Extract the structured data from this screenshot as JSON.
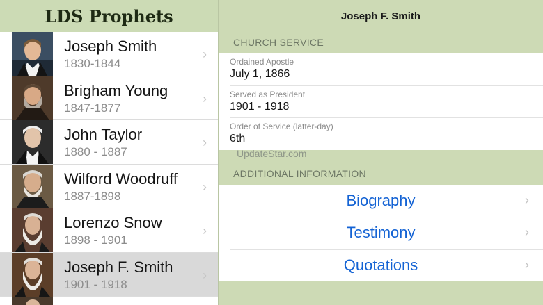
{
  "app": {
    "title": "LDS Prophets"
  },
  "prophets": [
    {
      "name": "Joseph Smith",
      "years": "1830-1844"
    },
    {
      "name": "Brigham Young",
      "years": "1847-1877"
    },
    {
      "name": "John Taylor",
      "years": "1880 - 1887"
    },
    {
      "name": "Wilford Woodruff",
      "years": "1887-1898"
    },
    {
      "name": "Lorenzo Snow",
      "years": "1898 - 1901"
    },
    {
      "name": "Joseph F. Smith",
      "years": "1901 - 1918"
    }
  ],
  "detail": {
    "title": "Joseph F. Smith",
    "church_service_label": "CHURCH SERVICE",
    "fields": [
      {
        "label": "Ordained Apostle",
        "value": "July 1, 1866"
      },
      {
        "label": "Served as President",
        "value": "1901 - 1918"
      },
      {
        "label": "Order of Service (latter-day)",
        "value": "6th"
      }
    ],
    "watermark": "UpdateStar.com",
    "additional_label": "ADDITIONAL INFORMATION",
    "links": [
      {
        "label": "Biography"
      },
      {
        "label": "Testimony"
      },
      {
        "label": "Quotations"
      }
    ]
  },
  "icons": {
    "chevron": "chevron-right-icon"
  }
}
